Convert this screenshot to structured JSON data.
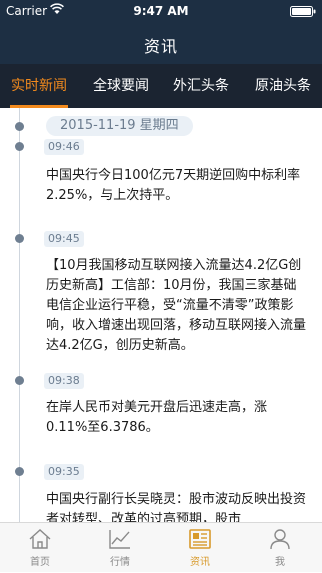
{
  "status_bar": {
    "carrier": "Carrier",
    "time": "9:47 AM"
  },
  "nav": {
    "title": "资讯"
  },
  "tabs": [
    {
      "label": "实时新闻",
      "active": true
    },
    {
      "label": "全球要闻",
      "active": false
    },
    {
      "label": "外汇头条",
      "active": false
    },
    {
      "label": "原油头条",
      "active": false
    }
  ],
  "feed": {
    "date": "2015-11-19 星期四",
    "items": [
      {
        "time": "09:46",
        "text": "中国央行今日100亿元7天期逆回购中标利率2.25%，与上次持平。"
      },
      {
        "time": "09:45",
        "text": "【10月我国移动互联网接入流量达4.2亿G创历史新高】工信部：10月份，我国三家基础电信企业运行平稳，受“流量不清零”政策影响，收入增速出现回落，移动互联网接入流量达4.2亿G，创历史新高。"
      },
      {
        "time": "09:38",
        "text": "在岸人民币对美元开盘后迅速走高，涨0.11%至6.3786。"
      },
      {
        "time": "09:35",
        "text": "中国央行副行长吴晓灵：股市波动反映出投资者对转型、改革的过高预期，股市"
      }
    ]
  },
  "tab_bar": [
    {
      "label": "首页",
      "icon": "home-icon",
      "active": false
    },
    {
      "label": "行情",
      "icon": "chart-icon",
      "active": false
    },
    {
      "label": "资讯",
      "icon": "news-icon",
      "active": true
    },
    {
      "label": "我",
      "icon": "person-icon",
      "active": false
    }
  ],
  "colors": {
    "nav_bg": "#1d2f43",
    "tabs_bg": "#1b2431",
    "accent": "#f28a1d",
    "tabbar_active": "#d89a2b"
  }
}
